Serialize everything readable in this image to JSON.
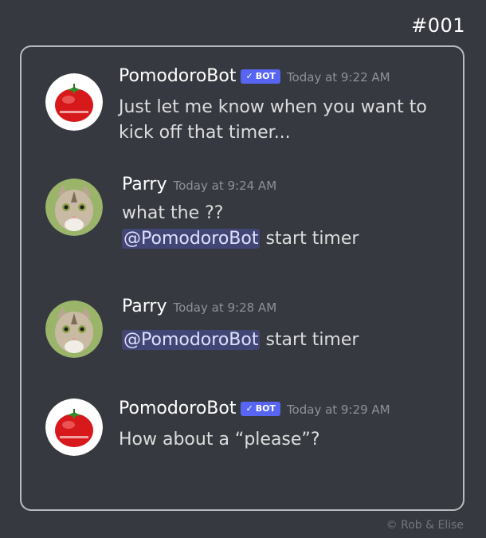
{
  "panel_id": "#001",
  "messages": [
    {
      "author": "PomodoroBot",
      "bot_tag": "BOT",
      "time": "Today at 9:22 AM",
      "lines": [
        "Just let me know when you want to",
        "kick off that timer..."
      ]
    },
    {
      "author": "Parry",
      "time": "Today at 9:24 AM",
      "line1": "what the ??",
      "mention": "@PomodoroBot",
      "after_mention": " start timer"
    },
    {
      "author": "Parry",
      "time": "Today at 9:28 AM",
      "mention": "@PomodoroBot",
      "after_mention": " start timer"
    },
    {
      "author": "PomodoroBot",
      "bot_tag": "BOT",
      "time": "Today at 9:29 AM",
      "line1": "How about a “please”?"
    }
  ],
  "credit": "©  Rob & Elise",
  "icons": {
    "bot_check": "checkmark-icon",
    "bot_avatar": "tomato-timer-icon",
    "user_avatar": "cat-avatar-icon"
  },
  "colors": {
    "background": "#36393f",
    "bot_tag": "#5865f2",
    "mention_bg": "#414675"
  }
}
